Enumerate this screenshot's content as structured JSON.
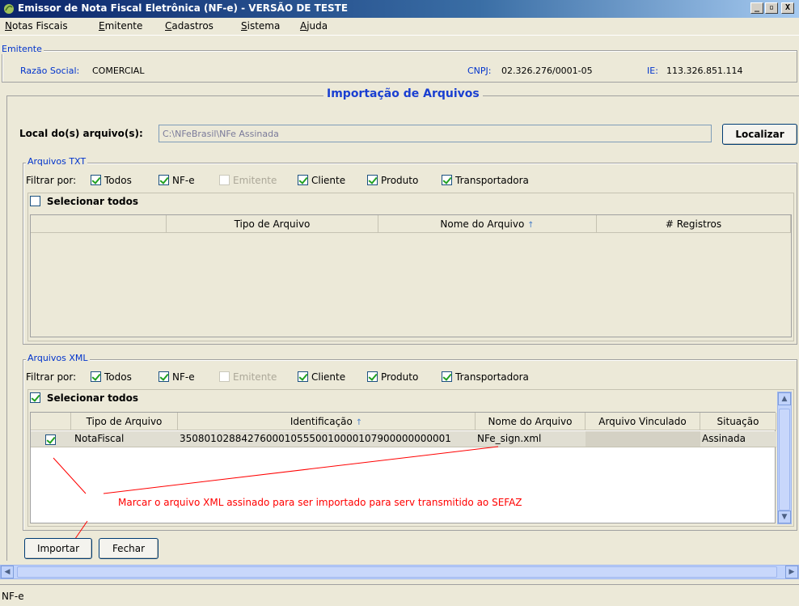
{
  "window": {
    "title": "Emissor de Nota Fiscal Eletrônica (NF-e) - VERSÃO DE TESTE",
    "minimize": "_",
    "maximize": "▫",
    "close": "X"
  },
  "menu": [
    {
      "label": "Notas Fiscais",
      "key": "N",
      "rest": "otas Fiscais"
    },
    {
      "label": "Emitente",
      "key": "E",
      "rest": "mitente"
    },
    {
      "label": "Cadastros",
      "key": "C",
      "rest": "adastros"
    },
    {
      "label": "Sistema",
      "key": "S",
      "rest": "istema"
    },
    {
      "label": "Ajuda",
      "key": "A",
      "rest": "juda"
    }
  ],
  "emitente": {
    "legend": "Emitente",
    "razao_label": "Razão Social:",
    "razao_value": "COMERCIAL",
    "cnpj_label": "CNPJ:",
    "cnpj_value": "02.326.276/0001-05",
    "ie_label": "IE:",
    "ie_value": "113.326.851.114"
  },
  "import": {
    "title": "Importação de Arquivos",
    "local_label": "Local do(s) arquivo(s):",
    "local_value": "C:\\NFeBrasil\\NFe Assinada",
    "localizar": "Localizar"
  },
  "txt": {
    "legend": "Arquivos TXT",
    "filter_label": "Filtrar por:",
    "filters": [
      {
        "label": "Todos",
        "checked": true,
        "disabled": false
      },
      {
        "label": "NF-e",
        "checked": true,
        "disabled": false
      },
      {
        "label": "Emitente",
        "checked": false,
        "disabled": true
      },
      {
        "label": "Cliente",
        "checked": true,
        "disabled": false
      },
      {
        "label": "Produto",
        "checked": true,
        "disabled": false
      },
      {
        "label": "Transportadora",
        "checked": true,
        "disabled": false
      }
    ],
    "select_all": "Selecionar todos",
    "select_all_checked": false,
    "columns": [
      "",
      "Tipo de Arquivo",
      "Nome do Arquivo",
      "# Registros"
    ],
    "sorted_column": "Nome do Arquivo"
  },
  "xml": {
    "legend": "Arquivos XML",
    "filter_label": "Filtrar por:",
    "filters": [
      {
        "label": "Todos",
        "checked": true,
        "disabled": false
      },
      {
        "label": "NF-e",
        "checked": true,
        "disabled": false
      },
      {
        "label": "Emitente",
        "checked": false,
        "disabled": true
      },
      {
        "label": "Cliente",
        "checked": true,
        "disabled": false
      },
      {
        "label": "Produto",
        "checked": true,
        "disabled": false
      },
      {
        "label": "Transportadora",
        "checked": true,
        "disabled": false
      }
    ],
    "select_all": "Selecionar todos",
    "select_all_checked": true,
    "columns": [
      "",
      "Tipo de Arquivo",
      "Identificação",
      "Nome do Arquivo",
      "Arquivo Vinculado",
      "Situação"
    ],
    "sorted_column": "Identificação",
    "rows": [
      {
        "checked": true,
        "tipo": "NotaFiscal",
        "identificacao": "35080102884276000105550010000107900000000001",
        "nome": "NFe_sign.xml",
        "vinculado": "",
        "situacao": "Assinada"
      }
    ]
  },
  "annotation": "Marcar o arquivo XML assinado para ser importado para serv transmitido ao SEFAZ",
  "buttons": {
    "importar": "Importar",
    "fechar": "Fechar"
  },
  "status_bar": "NF-e",
  "icons": {
    "sort": "sort-arrow-up-icon",
    "scroll_up": "▲",
    "scroll_down": "▼",
    "scroll_left": "◀",
    "scroll_right": "▶"
  }
}
